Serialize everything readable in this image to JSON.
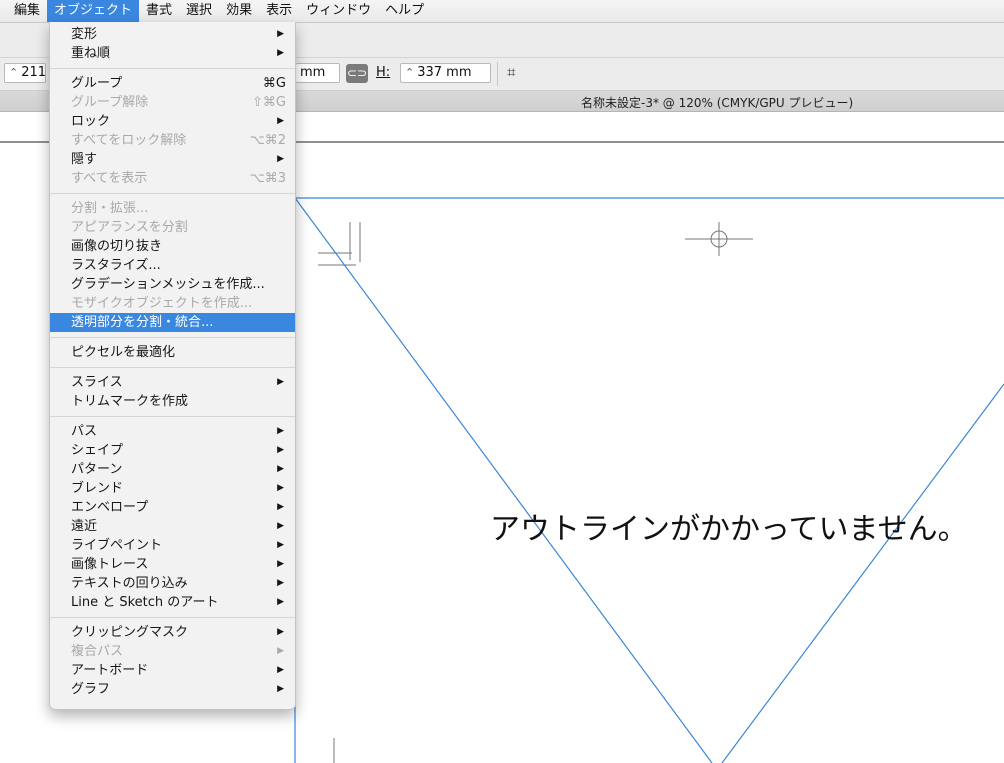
{
  "menubar": {
    "items": [
      "編集",
      "オブジェクト",
      "書式",
      "選択",
      "効果",
      "表示",
      "ウィンドウ",
      "ヘルプ"
    ],
    "active_index": 1,
    "accent_color": "#3a87e0"
  },
  "control_bar": {
    "w_value": "211",
    "w_unit_fragment": "mm",
    "link_icon": "link-icon",
    "h_label": "H:",
    "h_value": "337 mm",
    "transform_icon": "transform-icon"
  },
  "document": {
    "title": "名称未設定-3* @ 120% (CMYK/GPU プレビュー)"
  },
  "canvas": {
    "text": "アウトラインがかかっていません。",
    "line_color": "#3b86d6"
  },
  "menu": {
    "groups": [
      [
        {
          "label": "変形",
          "submenu": true
        },
        {
          "label": "重ね順",
          "submenu": true
        }
      ],
      [
        {
          "label": "グループ",
          "shortcut": "⌘G"
        },
        {
          "label": "グループ解除",
          "shortcut": "⇧⌘G",
          "disabled": true
        },
        {
          "label": "ロック",
          "submenu": true
        },
        {
          "label": "すべてをロック解除",
          "shortcut": "⌥⌘2",
          "disabled": true
        },
        {
          "label": "隠す",
          "submenu": true
        },
        {
          "label": "すべてを表示",
          "shortcut": "⌥⌘3",
          "disabled": true
        }
      ],
      [
        {
          "label": "分割・拡張...",
          "disabled": true
        },
        {
          "label": "アピアランスを分割",
          "disabled": true
        },
        {
          "label": "画像の切り抜き"
        },
        {
          "label": "ラスタライズ..."
        },
        {
          "label": "グラデーションメッシュを作成..."
        },
        {
          "label": "モザイクオブジェクトを作成...",
          "disabled": true
        },
        {
          "label": "透明部分を分割・統合...",
          "highlighted": true
        }
      ],
      [
        {
          "label": "ピクセルを最適化"
        }
      ],
      [
        {
          "label": "スライス",
          "submenu": true
        },
        {
          "label": "トリムマークを作成"
        }
      ],
      [
        {
          "label": "パス",
          "submenu": true
        },
        {
          "label": "シェイプ",
          "submenu": true
        },
        {
          "label": "パターン",
          "submenu": true
        },
        {
          "label": "ブレンド",
          "submenu": true
        },
        {
          "label": "エンベロープ",
          "submenu": true
        },
        {
          "label": "遠近",
          "submenu": true
        },
        {
          "label": "ライブペイント",
          "submenu": true
        },
        {
          "label": "画像トレース",
          "submenu": true
        },
        {
          "label": "テキストの回り込み",
          "submenu": true
        },
        {
          "label": "Line と Sketch のアート",
          "submenu": true
        }
      ],
      [
        {
          "label": "クリッピングマスク",
          "submenu": true
        },
        {
          "label": "複合パス",
          "submenu": true,
          "disabled": true
        },
        {
          "label": "アートボード",
          "submenu": true
        },
        {
          "label": "グラフ",
          "submenu": true
        }
      ]
    ]
  }
}
